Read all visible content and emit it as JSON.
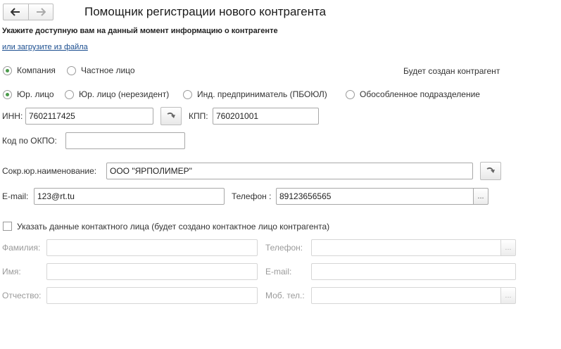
{
  "header": {
    "title": "Помощник регистрации нового контрагента"
  },
  "intro": {
    "instruction": "Укажите доступную вам на данный момент информацию о контрагенте",
    "load_link": "или загрузите из файла"
  },
  "entity_kind": {
    "options": [
      "Компания",
      "Частное лицо"
    ],
    "selected": 0,
    "info": "Будет создан контрагент"
  },
  "legal_form": {
    "options": [
      "Юр. лицо",
      "Юр. лицо (нерезидент)",
      "Инд. предприниматель (ПБОЮЛ)",
      "Обособленное подразделение"
    ],
    "selected": 0
  },
  "requisites": {
    "inn_label": "ИНН:",
    "inn_value": "7602117425",
    "kpp_label": "КПП:",
    "kpp_value": "760201001",
    "okpo_label": "Код по ОКПО:",
    "okpo_value": "",
    "short_name_label": "Сокр.юр.наименование:",
    "short_name_value": "ООО \"ЯРПОЛИМЕР\"",
    "email_label": "E-mail:",
    "email_value": "123@rt.tu",
    "phone_label": "Телефон :",
    "phone_value": "89123656565"
  },
  "contact": {
    "checkbox_label": "Указать данные контактного лица (будет создано контактное лицо контрагента)",
    "checked": false,
    "surname_label": "Фамилия:",
    "name_label": "Имя:",
    "patronymic_label": "Отчество:",
    "phone_label": "Телефон:",
    "email_label": "E-mail:",
    "mobile_label": "Моб. тел.:",
    "surname_value": "",
    "name_value": "",
    "patronymic_value": "",
    "phone_value": "",
    "email_value": "",
    "mobile_value": ""
  },
  "buttons": {
    "ellipsis": "..."
  },
  "colors": {
    "radio_selected": "#4a9a4a",
    "link": "#1a4d8f",
    "disabled_text": "#9a9a9a"
  }
}
